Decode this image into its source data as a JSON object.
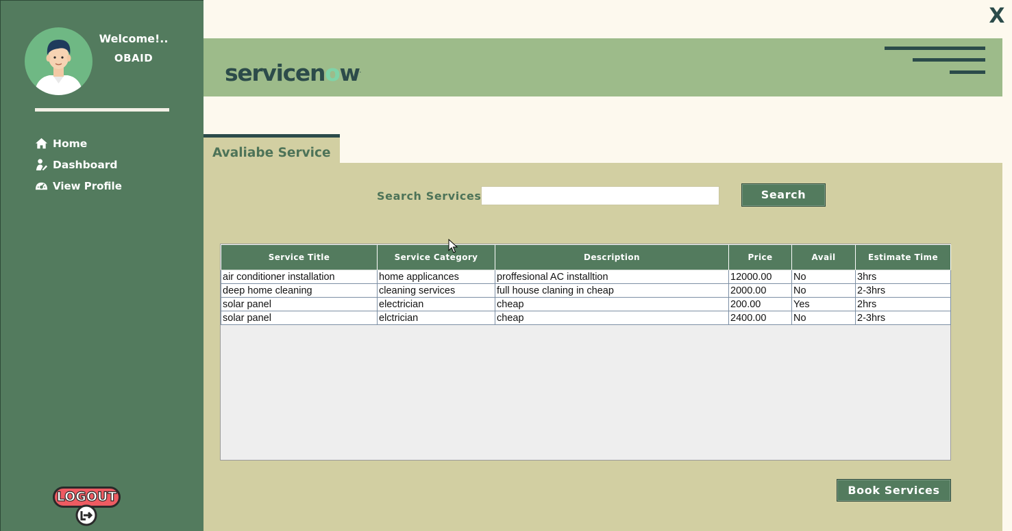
{
  "window": {
    "close_label": "X"
  },
  "sidebar": {
    "welcome": "Welcome!..",
    "username": "OBAID",
    "nav": [
      {
        "label": "Home",
        "icon": "home-icon"
      },
      {
        "label": "Dashboard",
        "icon": "dashboard-icon"
      },
      {
        "label": "View  Profile",
        "icon": "view-profile-icon"
      }
    ],
    "logout_label": "LOGOUT"
  },
  "header": {
    "brand_pre": "servicen",
    "brand_o": "o",
    "brand_post": "w",
    "brand_mark": "."
  },
  "tab": {
    "label": "Avaliabe Service"
  },
  "search": {
    "label": "Search Services",
    "placeholder": "",
    "value": "",
    "button_label": "Search"
  },
  "table": {
    "columns": [
      "Service Title",
      "Service Category",
      "Description",
      "Price",
      "Avail",
      "Estimate Time"
    ],
    "rows": [
      [
        "air conditioner installation",
        "home applicances",
        "proffesional AC installtion",
        "12000.00",
        "No",
        "3hrs"
      ],
      [
        "deep home cleaning",
        "cleaning services",
        "full house claning in cheap",
        "2000.00",
        "No",
        "2-3hrs"
      ],
      [
        "solar panel",
        "electrician",
        "cheap",
        "200.00",
        "Yes",
        "2hrs"
      ],
      [
        "solar panel",
        "elctrician",
        "cheap",
        "2400.00",
        "No",
        "2-3hrs"
      ]
    ]
  },
  "actions": {
    "book_label": "Book Services"
  },
  "colors": {
    "sidebar": "#537b5e",
    "header_band": "#9dbb8a",
    "panel": "#d2cfa2",
    "background": "#fdf9ee",
    "accent_dark": "#2b4b4a",
    "logout_red": "#ee5b62"
  }
}
